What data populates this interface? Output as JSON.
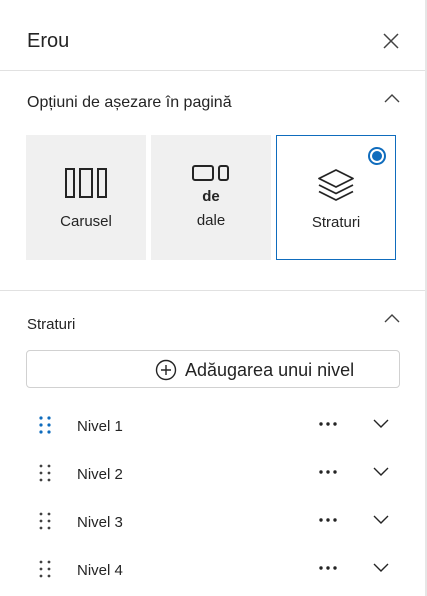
{
  "header": {
    "title": "Erou"
  },
  "layout_section": {
    "title": "Opțiuni de așezare în pagină",
    "options": [
      {
        "label": "Carusel",
        "icon": "carousel-icon",
        "selected": false
      },
      {
        "label_line1": "de",
        "label_line2": "dale",
        "icon": "tiles-icon",
        "selected": false
      },
      {
        "label": "Straturi",
        "icon": "layers-icon",
        "selected": true
      }
    ]
  },
  "layers_section": {
    "title": "Straturi",
    "add_button_label": "Adăugarea unui nivel",
    "items": [
      {
        "label": "Nivel 1",
        "drag_color": "#0f6cbd"
      },
      {
        "label": "Nivel 2",
        "drag_color": "#424242"
      },
      {
        "label": "Nivel 3",
        "drag_color": "#424242"
      },
      {
        "label": "Nivel 4",
        "drag_color": "#424242"
      }
    ]
  },
  "colors": {
    "accent": "#0f6cbd",
    "card_bg": "#f0f0f0",
    "divider": "#e1e1e1"
  }
}
